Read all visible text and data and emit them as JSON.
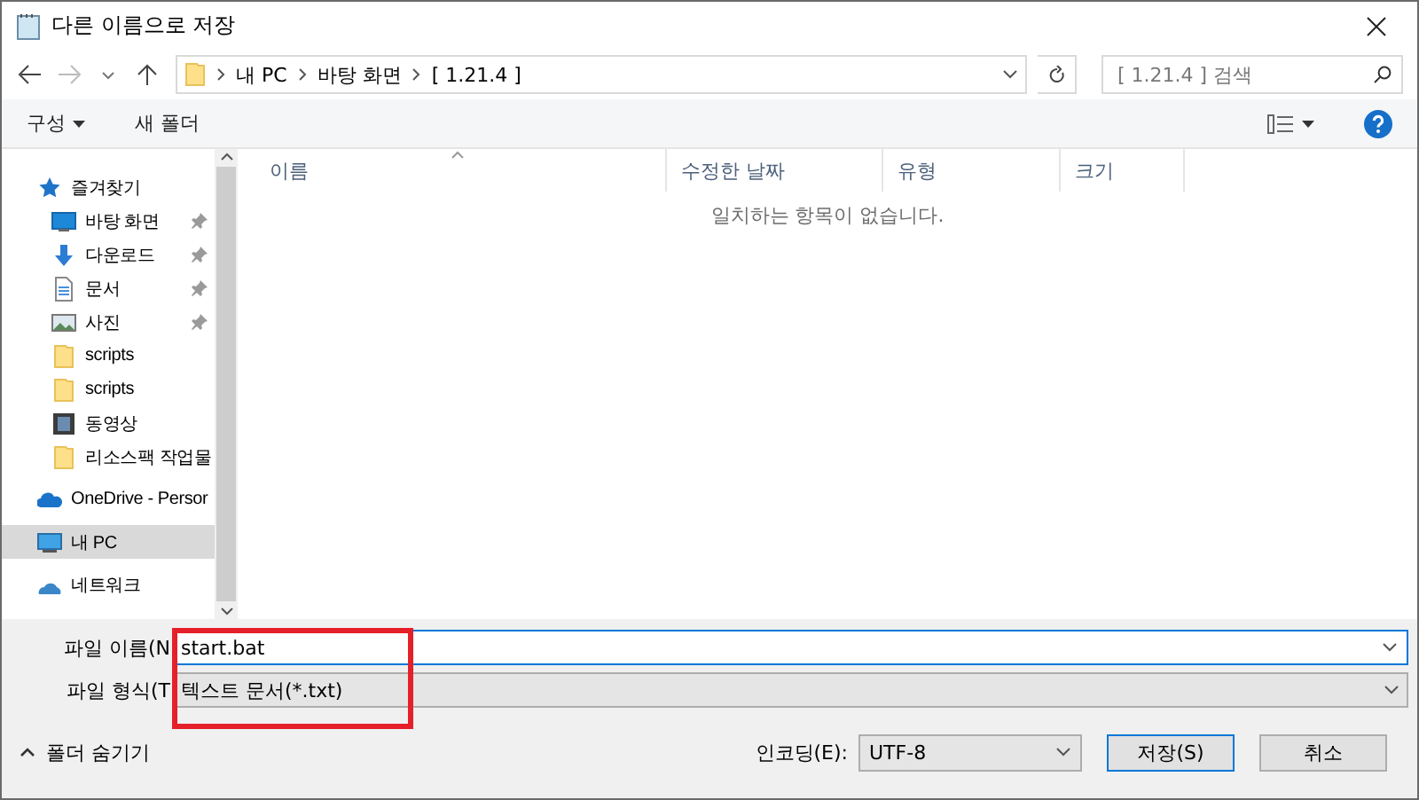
{
  "window": {
    "title": "다른 이름으로 저장"
  },
  "address": {
    "path": [
      {
        "label": "내 PC"
      },
      {
        "label": "바탕 화면"
      },
      {
        "label": "[ 1.21.4 ]"
      }
    ],
    "search_placeholder": "[ 1.21.4 ] 검색"
  },
  "toolbar": {
    "organize": "구성",
    "new_folder": "새 폴더"
  },
  "sidebar": {
    "items": [
      {
        "label": "즐겨찾기",
        "kind": "star",
        "pinned": false,
        "selected": false,
        "indent": false
      },
      {
        "label": "바탕 화면",
        "kind": "desktop",
        "pinned": true,
        "selected": false,
        "indent": true,
        "gap": false
      },
      {
        "label": "다운로드",
        "kind": "download",
        "pinned": true,
        "selected": false,
        "indent": true,
        "gap": false
      },
      {
        "label": "문서",
        "kind": "document",
        "pinned": true,
        "selected": false,
        "indent": true,
        "gap": false
      },
      {
        "label": "사진",
        "kind": "image",
        "pinned": true,
        "selected": false,
        "indent": true,
        "gap": false
      },
      {
        "label": "scripts",
        "kind": "folder",
        "pinned": false,
        "selected": false,
        "indent": true,
        "gap": false
      },
      {
        "label": "scripts",
        "kind": "folder",
        "pinned": false,
        "selected": false,
        "indent": true,
        "gap": false
      },
      {
        "label": "동영상",
        "kind": "video",
        "pinned": false,
        "selected": false,
        "indent": true,
        "gap": false
      },
      {
        "label": "리소스팩 작업물",
        "kind": "folder",
        "pinned": false,
        "selected": false,
        "indent": true,
        "gap": false
      },
      {
        "label": "OneDrive - Persor",
        "kind": "cloud",
        "pinned": false,
        "selected": false,
        "indent": false,
        "gap": true
      },
      {
        "label": "내 PC",
        "kind": "pc",
        "pinned": false,
        "selected": true,
        "indent": false,
        "gap": true
      },
      {
        "label": "네트워크",
        "kind": "network",
        "pinned": false,
        "selected": false,
        "indent": false,
        "gap": true
      }
    ]
  },
  "table": {
    "columns": [
      {
        "label": "이름"
      },
      {
        "label": "수정한 날짜"
      },
      {
        "label": "유형"
      },
      {
        "label": "크기"
      }
    ],
    "empty_message": "일치하는 항목이 없습니다."
  },
  "form": {
    "filename_label": "파일 이름(N",
    "filename": "start.bat",
    "filetype_label": "파일 형식(T",
    "filetype": "텍스트 문서(*.txt)"
  },
  "footer": {
    "hide_folders": "폴더 숨기기",
    "encoding_label": "인코딩(E):",
    "encoding": "UTF-8",
    "save": "저장(S)",
    "cancel": "취소"
  }
}
